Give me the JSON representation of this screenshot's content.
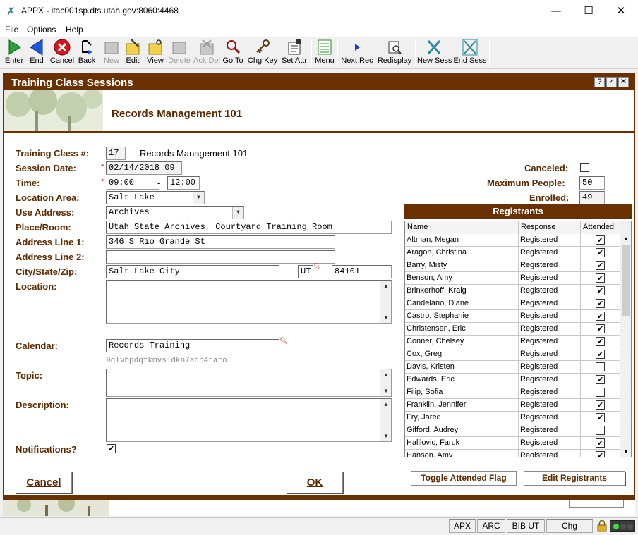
{
  "window": {
    "title": "APPX - itac001sp.dts.utah.gov:8060:4468"
  },
  "menubar": {
    "items": [
      "File",
      "Options",
      "Help"
    ]
  },
  "toolbar": {
    "buttons": [
      {
        "label": "Enter",
        "icon": "play-icon"
      },
      {
        "label": "End",
        "icon": "back-arrow-icon"
      },
      {
        "label": "Cancel",
        "icon": "cancel-icon"
      },
      {
        "label": "Back",
        "icon": "back-icon"
      },
      {
        "label": "New",
        "icon": "new-icon",
        "disabled": true
      },
      {
        "label": "Edit",
        "icon": "edit-icon"
      },
      {
        "label": "View",
        "icon": "view-icon"
      },
      {
        "label": "Delete",
        "icon": "delete-icon",
        "disabled": true
      },
      {
        "label": "Ack Del",
        "icon": "ack-delete-icon",
        "disabled": true
      },
      {
        "label": "Go To",
        "icon": "magnifier-icon"
      },
      {
        "label": "Chg Key",
        "icon": "key-icon"
      },
      {
        "label": "Set Attr",
        "icon": "set-attr-icon"
      },
      {
        "label": "Menu",
        "icon": "menu-icon"
      },
      {
        "label": "Next Rec",
        "icon": "next-icon"
      },
      {
        "label": "Redisplay",
        "icon": "redisplay-icon"
      },
      {
        "label": "New Sess",
        "icon": "new-session-icon"
      },
      {
        "label": "End Sess",
        "icon": "end-session-icon"
      }
    ]
  },
  "form": {
    "window_title": "Training Class Sessions",
    "header_title": "Records Management 101",
    "labels": {
      "class_no": "Training Class #:",
      "session_date": "Session Date:",
      "time": "Time:",
      "location_area": "Location Area:",
      "use_address": "Use Address:",
      "place_room": "Place/Room:",
      "address1": "Address Line 1:",
      "address2": "Address Line 2:",
      "city_state_zip": "City/State/Zip:",
      "location": "Location:",
      "calendar": "Calendar:",
      "topic": "Topic:",
      "description": "Description:",
      "notifications": "Notifications?",
      "canceled": "Canceled:",
      "max_people": "Maximum People:",
      "enrolled": "Enrolled:"
    },
    "values": {
      "class_no": "17",
      "class_name": "Records Management 101",
      "session_date": "02/14/2018 09",
      "time_start": "09:00",
      "time_sep": "-",
      "time_end": "12:00",
      "location_area": "Salt Lake",
      "use_address": "Archives",
      "place_room": "Utah State Archives, Courtyard Training Room",
      "address1": "346 S Rio Grande St",
      "address2": "",
      "city": "Salt Lake City",
      "state": "UT",
      "zip": "84101",
      "location": "",
      "calendar": "Records Training",
      "calendar_id": "9qlvbpdqfkmvsldkn7adb4raro",
      "topic": "",
      "description": "",
      "notifications": true,
      "canceled": false,
      "max_people": "50",
      "enrolled": "49"
    },
    "required_marker": "*",
    "lookup_icon": "magnifier-icon"
  },
  "registrants": {
    "title": "Registrants",
    "columns": [
      "Name",
      "Response",
      "Attended"
    ],
    "rows": [
      {
        "name": "Altman, Megan",
        "response": "Registered",
        "attended": true
      },
      {
        "name": "Aragon, Christina",
        "response": "Registered",
        "attended": true
      },
      {
        "name": "Barry, Misty",
        "response": "Registered",
        "attended": true
      },
      {
        "name": "Benson, Amy",
        "response": "Registered",
        "attended": true
      },
      {
        "name": "Brinkerhoff, Kraig",
        "response": "Registered",
        "attended": true
      },
      {
        "name": "Candelario, Diane",
        "response": "Registered",
        "attended": true
      },
      {
        "name": "Castro, Stephanie",
        "response": "Registered",
        "attended": true
      },
      {
        "name": "Christensen, Eric",
        "response": "Registered",
        "attended": true
      },
      {
        "name": "Conner, Chelsey",
        "response": "Registered",
        "attended": true
      },
      {
        "name": "Cox, Greg",
        "response": "Registered",
        "attended": true
      },
      {
        "name": "Davis, Kristen",
        "response": "Registered",
        "attended": false
      },
      {
        "name": "Edwards, Eric",
        "response": "Registered",
        "attended": true
      },
      {
        "name": "Filip, Sofia",
        "response": "Registered",
        "attended": false
      },
      {
        "name": "Franklin, Jennifer",
        "response": "Registered",
        "attended": true
      },
      {
        "name": "Fry, Jared",
        "response": "Registered",
        "attended": true
      },
      {
        "name": "Gifford, Audrey",
        "response": "Registered",
        "attended": false
      },
      {
        "name": "Halilovic, Faruk",
        "response": "Registered",
        "attended": true
      },
      {
        "name": "Hanson, Amy",
        "response": "Registered",
        "attended": true
      }
    ]
  },
  "buttons": {
    "cancel": "Cancel",
    "ok": "OK",
    "toggle_attended": "Toggle Attended Flag",
    "edit_registrants": "Edit Registrants"
  },
  "status_bar": {
    "cells": [
      "APX",
      "ARC",
      "BIB UT",
      "Chg"
    ]
  }
}
